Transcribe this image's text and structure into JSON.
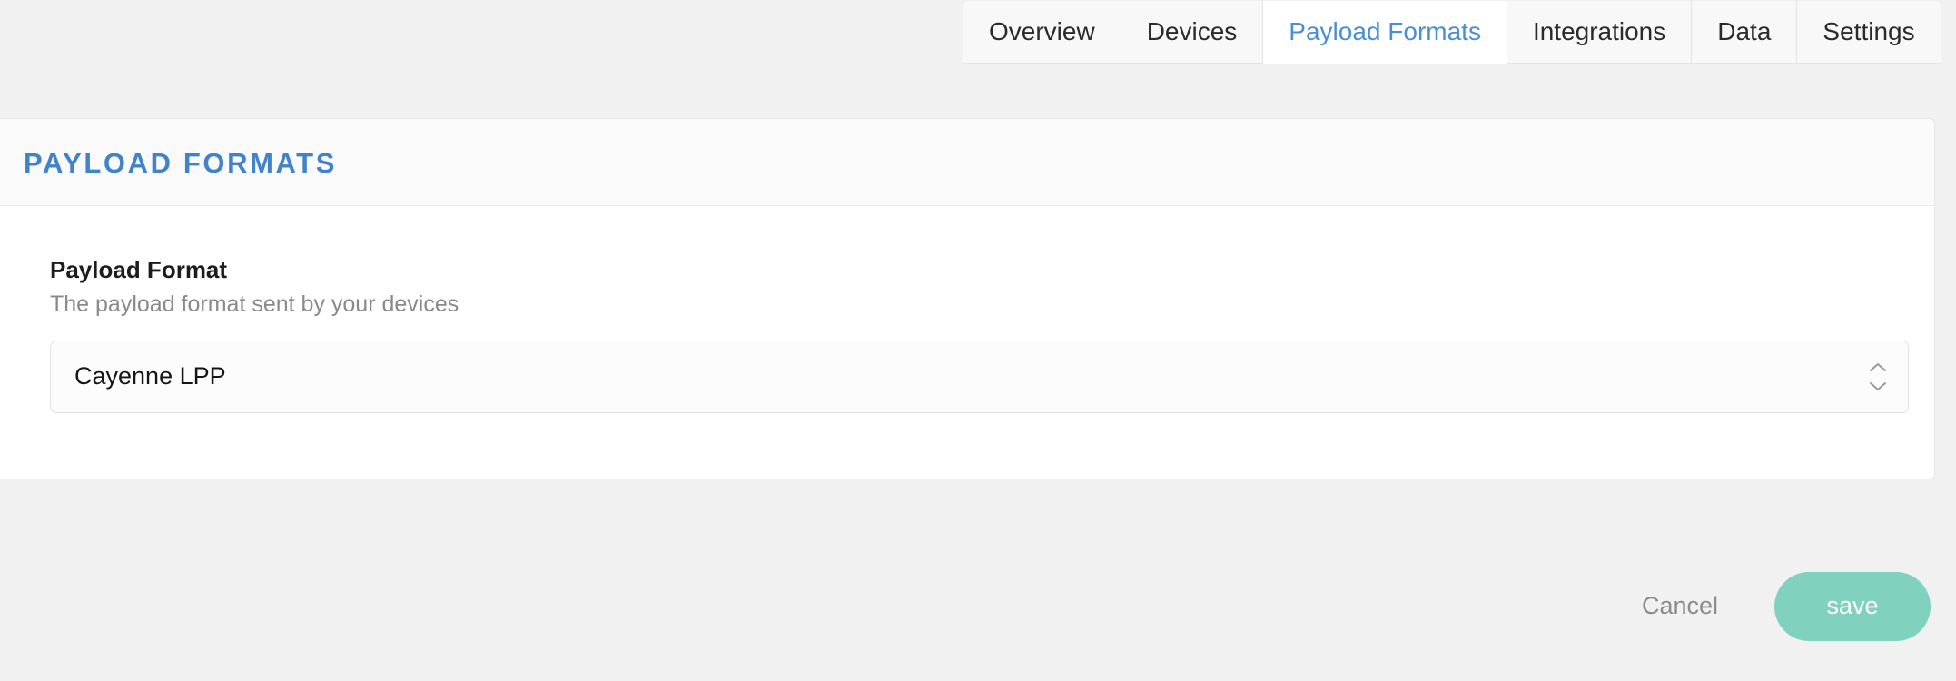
{
  "tabs": [
    {
      "label": "Overview",
      "active": false
    },
    {
      "label": "Devices",
      "active": false
    },
    {
      "label": "Payload Formats",
      "active": true
    },
    {
      "label": "Integrations",
      "active": false
    },
    {
      "label": "Data",
      "active": false
    },
    {
      "label": "Settings",
      "active": false
    }
  ],
  "panel": {
    "title": "PAYLOAD FORMATS"
  },
  "field": {
    "label": "Payload Format",
    "help": "The payload format sent by your devices",
    "selected_value": "Cayenne LPP",
    "stepper_icon": "chevron-up-down-icon"
  },
  "footer": {
    "cancel_label": "Cancel",
    "save_label": "save"
  },
  "colors": {
    "accent_blue": "#4a8fd4",
    "title_blue": "#4183ca",
    "save_green": "#80d2bf",
    "page_background": "#f1f1f1",
    "panel_header": "#fafafa"
  }
}
